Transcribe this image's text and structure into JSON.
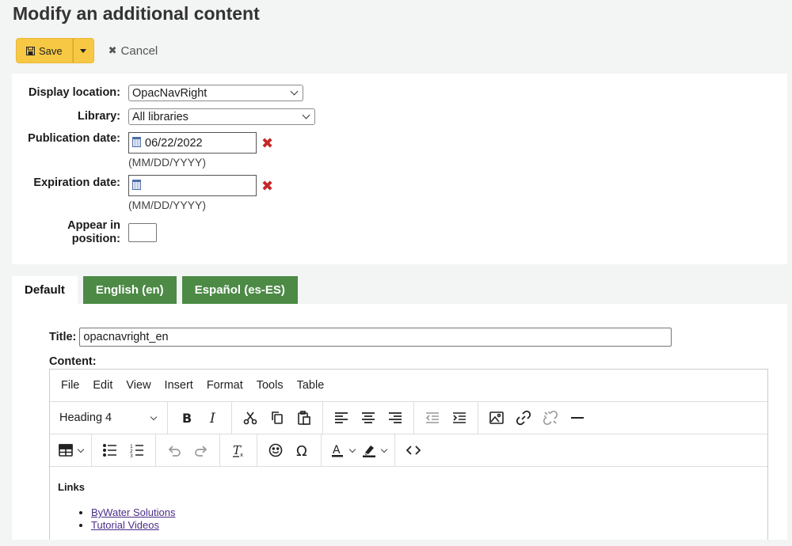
{
  "page": {
    "title": "Modify an additional content"
  },
  "toolbar": {
    "save_label": "Save",
    "cancel_label": "Cancel"
  },
  "form": {
    "display_location": {
      "label": "Display location:",
      "value": "OpacNavRight"
    },
    "library": {
      "label": "Library:",
      "value": "All libraries"
    },
    "publication_date": {
      "label": "Publication date:",
      "value": "06/22/2022",
      "hint": "(MM/DD/YYYY)"
    },
    "expiration_date": {
      "label": "Expiration date:",
      "value": "",
      "hint": "(MM/DD/YYYY)"
    },
    "position": {
      "label_line1": "Appear in",
      "label_line2": "position:",
      "value": ""
    }
  },
  "tabs": [
    {
      "label": "Default",
      "active": true
    },
    {
      "label": "English (en)",
      "active": false
    },
    {
      "label": "Español (es-ES)",
      "active": false
    }
  ],
  "content_form": {
    "title_label": "Title:",
    "title_value": "opacnavright_en",
    "content_label": "Content:"
  },
  "editor": {
    "menu": [
      "File",
      "Edit",
      "View",
      "Insert",
      "Format",
      "Tools",
      "Table"
    ],
    "block_format": "Heading 4",
    "body": {
      "heading": "Links",
      "links": [
        "ByWater Solutions",
        "Tutorial Videos"
      ]
    }
  },
  "colors": {
    "save_button": "#f7c843",
    "tab_green": "#4c8a46",
    "clear_x": "#c62828",
    "link": "#4b2d8a"
  }
}
